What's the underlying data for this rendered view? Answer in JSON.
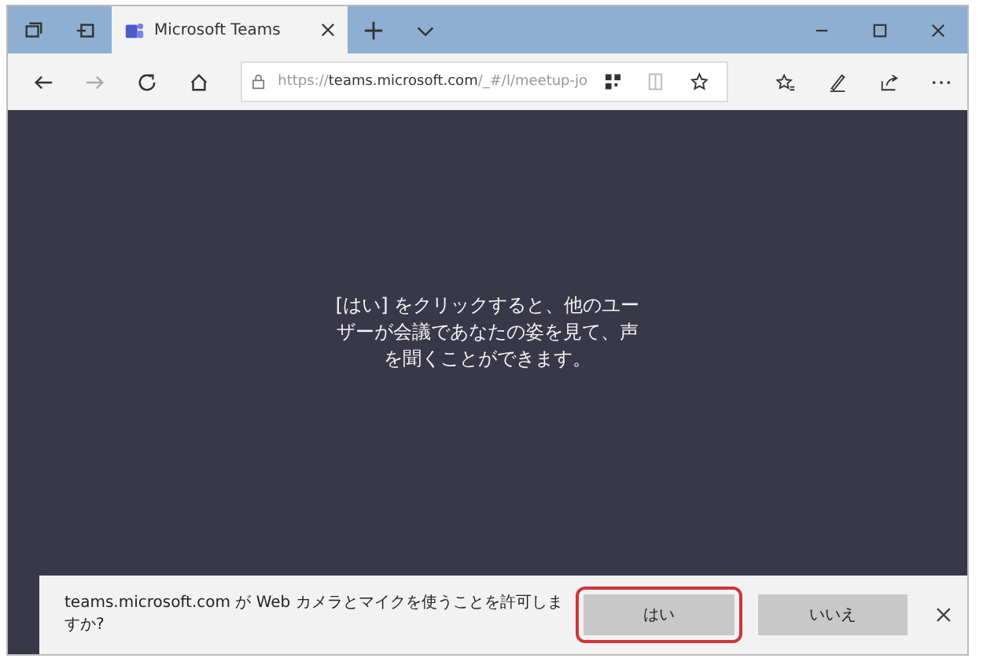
{
  "tab": {
    "title": "Microsoft Teams",
    "selected": true
  },
  "address_bar": {
    "url": "https://**teams.microsoft.com**/_#/l/meetup-jo"
  },
  "content": {
    "message": "[はい] をクリックすると、他のユーザーが会議であなたの姿を見て、声を聞くことができます。"
  },
  "notification": {
    "text": "teams.microsoft.com が Web カメラとマイクを使うことを許可しますか?",
    "buttons": [
      {
        "label": "はい",
        "highlighted": true
      },
      {
        "label": "いいえ",
        "highlighted": false
      }
    ]
  }
}
